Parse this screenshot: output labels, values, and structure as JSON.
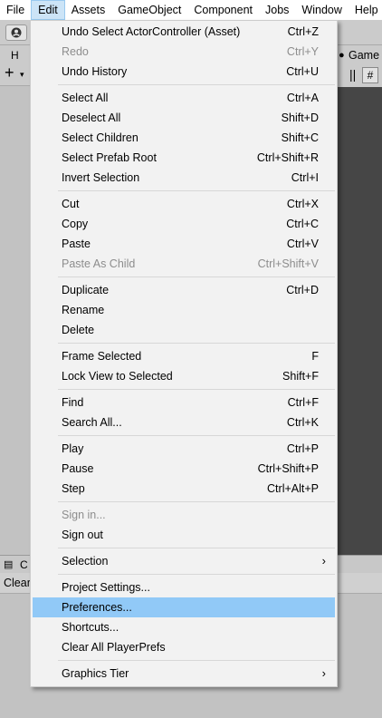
{
  "menubar": {
    "items": [
      {
        "label": "File"
      },
      {
        "label": "Edit"
      },
      {
        "label": "Assets"
      },
      {
        "label": "GameObject"
      },
      {
        "label": "Component"
      },
      {
        "label": "Jobs"
      },
      {
        "label": "Window"
      },
      {
        "label": "Help"
      }
    ]
  },
  "hierarchy": {
    "tab_label": "H",
    "add_symbol": "+",
    "caret": "▾"
  },
  "game": {
    "tab_label": "Game",
    "tab_icon": "●",
    "bars": "||",
    "grid_icon": "#"
  },
  "console": {
    "tab_label": "C",
    "tab_icon": "▤",
    "clear_label": "Clear"
  },
  "edit_menu": {
    "groups": [
      [
        {
          "label": "Undo Select ActorController (Asset)",
          "shortcut": "Ctrl+Z"
        },
        {
          "label": "Redo",
          "shortcut": "Ctrl+Y",
          "disabled": true
        },
        {
          "label": "Undo History",
          "shortcut": "Ctrl+U"
        }
      ],
      [
        {
          "label": "Select All",
          "shortcut": "Ctrl+A"
        },
        {
          "label": "Deselect All",
          "shortcut": "Shift+D"
        },
        {
          "label": "Select Children",
          "shortcut": "Shift+C"
        },
        {
          "label": "Select Prefab Root",
          "shortcut": "Ctrl+Shift+R"
        },
        {
          "label": "Invert Selection",
          "shortcut": "Ctrl+I"
        }
      ],
      [
        {
          "label": "Cut",
          "shortcut": "Ctrl+X"
        },
        {
          "label": "Copy",
          "shortcut": "Ctrl+C"
        },
        {
          "label": "Paste",
          "shortcut": "Ctrl+V"
        },
        {
          "label": "Paste As Child",
          "shortcut": "Ctrl+Shift+V",
          "disabled": true
        }
      ],
      [
        {
          "label": "Duplicate",
          "shortcut": "Ctrl+D"
        },
        {
          "label": "Rename",
          "shortcut": ""
        },
        {
          "label": "Delete",
          "shortcut": ""
        }
      ],
      [
        {
          "label": "Frame Selected",
          "shortcut": "F"
        },
        {
          "label": "Lock View to Selected",
          "shortcut": "Shift+F"
        }
      ],
      [
        {
          "label": "Find",
          "shortcut": "Ctrl+F"
        },
        {
          "label": "Search All...",
          "shortcut": "Ctrl+K"
        }
      ],
      [
        {
          "label": "Play",
          "shortcut": "Ctrl+P"
        },
        {
          "label": "Pause",
          "shortcut": "Ctrl+Shift+P"
        },
        {
          "label": "Step",
          "shortcut": "Ctrl+Alt+P"
        }
      ],
      [
        {
          "label": "Sign in...",
          "shortcut": "",
          "disabled": true
        },
        {
          "label": "Sign out",
          "shortcut": ""
        }
      ],
      [
        {
          "label": "Selection",
          "shortcut": "",
          "submenu": true
        }
      ],
      [
        {
          "label": "Project Settings...",
          "shortcut": ""
        },
        {
          "label": "Preferences...",
          "shortcut": "",
          "highlighted": true
        },
        {
          "label": "Shortcuts...",
          "shortcut": ""
        },
        {
          "label": "Clear All PlayerPrefs",
          "shortcut": ""
        }
      ],
      [
        {
          "label": "Graphics Tier",
          "shortcut": "",
          "submenu": true
        }
      ]
    ],
    "submenu_arrow": "›"
  }
}
